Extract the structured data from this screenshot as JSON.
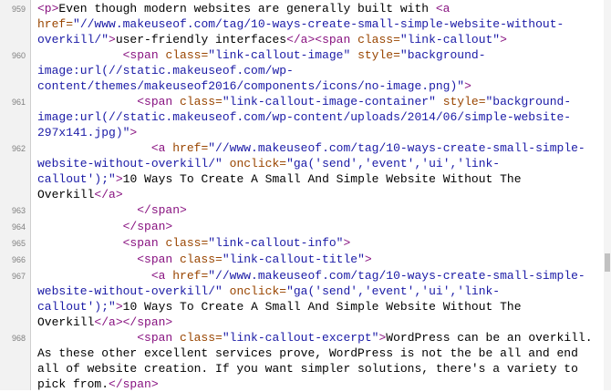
{
  "source_lines": [
    {
      "number": "959",
      "lines": [
        [
          [
            "t",
            "<p>"
          ],
          [
            "x",
            "Even though modern websites are generally built with "
          ],
          [
            "t",
            "<a"
          ]
        ],
        [
          [
            "a",
            "href="
          ],
          [
            "v",
            "\"//www.makeuseof.com/tag/10-ways-create-small-simple-website-without-"
          ]
        ],
        [
          [
            "v",
            "overkill/\""
          ],
          [
            "t",
            ">"
          ],
          [
            "x",
            "user-friendly interfaces"
          ],
          [
            "t",
            "</a><span "
          ],
          [
            "a",
            "class="
          ],
          [
            "v",
            "\"link-callout\""
          ],
          [
            "t",
            ">"
          ]
        ]
      ]
    },
    {
      "number": "960",
      "lines": [
        [
          [
            "t",
            "            <span "
          ],
          [
            "a",
            "class="
          ],
          [
            "v",
            "\"link-callout-image\""
          ],
          [
            "a",
            " style="
          ],
          [
            "v",
            "\"background-"
          ]
        ],
        [
          [
            "v",
            "image:url(//static.makeuseof.com/wp-"
          ]
        ],
        [
          [
            "v",
            "content/themes/makeuseof2016/components/icons/no-image.png)\""
          ],
          [
            "t",
            ">"
          ]
        ]
      ]
    },
    {
      "number": "961",
      "lines": [
        [
          [
            "t",
            "              <span "
          ],
          [
            "a",
            "class="
          ],
          [
            "v",
            "\"link-callout-image-container\""
          ],
          [
            "a",
            " style="
          ],
          [
            "v",
            "\"background-"
          ]
        ],
        [
          [
            "v",
            "image:url(//static.makeuseof.com/wp-content/uploads/2014/06/simple-website-"
          ]
        ],
        [
          [
            "v",
            "297x141.jpg)\""
          ],
          [
            "t",
            ">"
          ]
        ]
      ]
    },
    {
      "number": "962",
      "lines": [
        [
          [
            "t",
            "                <a "
          ],
          [
            "a",
            "href="
          ],
          [
            "v",
            "\"//www.makeuseof.com/tag/10-ways-create-small-simple-"
          ]
        ],
        [
          [
            "v",
            "website-without-overkill/\""
          ],
          [
            "a",
            " onclick="
          ],
          [
            "v",
            "\"ga('send','event','ui','link-"
          ]
        ],
        [
          [
            "v",
            "callout');\""
          ],
          [
            "t",
            ">"
          ],
          [
            "x",
            "10 Ways To Create A Small And Simple Website Without The"
          ]
        ],
        [
          [
            "x",
            "Overkill"
          ],
          [
            "t",
            "</a>"
          ]
        ]
      ]
    },
    {
      "number": "963",
      "lines": [
        [
          [
            "t",
            "              </span>"
          ]
        ]
      ]
    },
    {
      "number": "964",
      "lines": [
        [
          [
            "t",
            "            </span>"
          ]
        ]
      ]
    },
    {
      "number": "965",
      "lines": [
        [
          [
            "t",
            "            <span "
          ],
          [
            "a",
            "class="
          ],
          [
            "v",
            "\"link-callout-info\""
          ],
          [
            "t",
            ">"
          ]
        ]
      ]
    },
    {
      "number": "966",
      "lines": [
        [
          [
            "t",
            "              <span "
          ],
          [
            "a",
            "class="
          ],
          [
            "v",
            "\"link-callout-title\""
          ],
          [
            "t",
            ">"
          ]
        ]
      ]
    },
    {
      "number": "967",
      "lines": [
        [
          [
            "t",
            "                <a "
          ],
          [
            "a",
            "href="
          ],
          [
            "v",
            "\"//www.makeuseof.com/tag/10-ways-create-small-simple-"
          ]
        ],
        [
          [
            "v",
            "website-without-overkill/\""
          ],
          [
            "a",
            " onclick="
          ],
          [
            "v",
            "\"ga('send','event','ui','link-"
          ]
        ],
        [
          [
            "v",
            "callout');\""
          ],
          [
            "t",
            ">"
          ],
          [
            "x",
            "10 Ways To Create A Small And Simple Website Without The"
          ]
        ],
        [
          [
            "x",
            "Overkill"
          ],
          [
            "t",
            "</a></span>"
          ]
        ]
      ]
    },
    {
      "number": "968",
      "lines": [
        [
          [
            "t",
            "              <span "
          ],
          [
            "a",
            "class="
          ],
          [
            "v",
            "\"link-callout-excerpt\""
          ],
          [
            "t",
            ">"
          ],
          [
            "x",
            "WordPress can be an overkill."
          ]
        ],
        [
          [
            "x",
            "As these other excellent services prove, WordPress is not the be all and end"
          ]
        ],
        [
          [
            "x",
            "all of website creation. If you want simpler solutions, there's a variety to"
          ]
        ],
        [
          [
            "x",
            "pick from."
          ],
          [
            "t",
            "</span>"
          ]
        ]
      ]
    }
  ],
  "colors": {
    "tag": "#881280",
    "attribute": "#994500",
    "value": "#1a1aa6",
    "text": "#000000"
  }
}
